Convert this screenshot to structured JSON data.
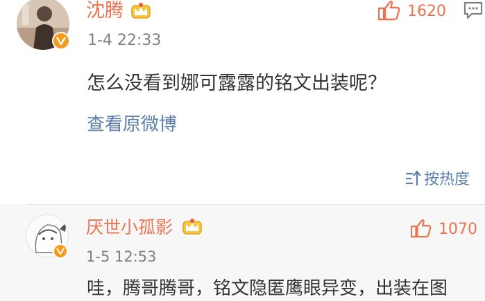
{
  "main_comment": {
    "username": "沈腾",
    "time": "1-4 22:33",
    "like_count": "1620",
    "content": "怎么没看到娜可露露的铭文出装呢？",
    "view_original_label": "查看原微博"
  },
  "sort": {
    "label": "按热度"
  },
  "reply": {
    "username": "厌世小孤影",
    "time": "1-5 12:53",
    "like_count": "1070",
    "content": "哇，腾哥腾哥，铭文隐匿鹰眼异变，出装在图"
  },
  "colors": {
    "username": "#eb7350",
    "link": "#5b7fad",
    "badge": "#f59a1b",
    "text": "#333333",
    "meta": "#808080"
  }
}
